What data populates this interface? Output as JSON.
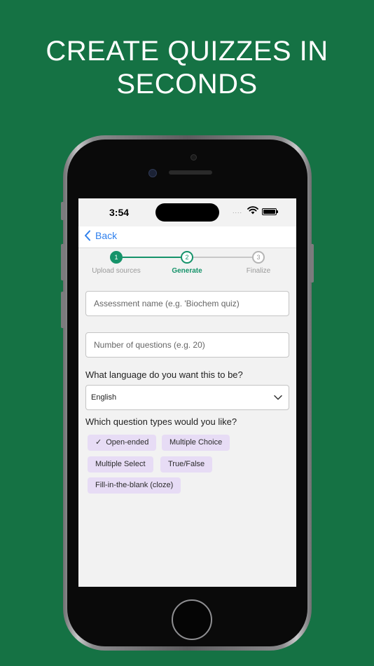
{
  "headline": {
    "line1": "CREATE QUIZZES IN",
    "line2": "SECONDS"
  },
  "status_bar": {
    "time": "3:54",
    "signal": "....",
    "wifi_icon": "wifi-icon",
    "battery_icon": "battery-icon"
  },
  "nav": {
    "back_label": "Back",
    "back_icon": "chevron-left-icon"
  },
  "stepper": {
    "steps": [
      {
        "number": "1",
        "label": "Upload sources",
        "state": "done"
      },
      {
        "number": "2",
        "label": "Generate",
        "state": "active"
      },
      {
        "number": "3",
        "label": "Finalize",
        "state": "pending"
      }
    ]
  },
  "form": {
    "assessment_name": {
      "value": "",
      "placeholder": "Assessment name (e.g. 'Biochem quiz)"
    },
    "question_count": {
      "value": "",
      "placeholder": "Number of questions (e.g. 20)"
    },
    "language_question": "What language do you want this to be?",
    "language_selected": "English",
    "types_question": "Which question types would you like?",
    "question_types": [
      {
        "label": "Open-ended",
        "selected": true
      },
      {
        "label": "Multiple Choice",
        "selected": false
      },
      {
        "label": "Multiple Select",
        "selected": false
      },
      {
        "label": "True/False",
        "selected": false
      },
      {
        "label": "Fill-in-the-blank (cloze)",
        "selected": false
      }
    ]
  },
  "colors": {
    "background": "#157244",
    "accent_green": "#16936a",
    "chip_bg": "#e7dcf5",
    "link_blue": "#2f80ed",
    "pending_gray": "#b5b5b5"
  }
}
